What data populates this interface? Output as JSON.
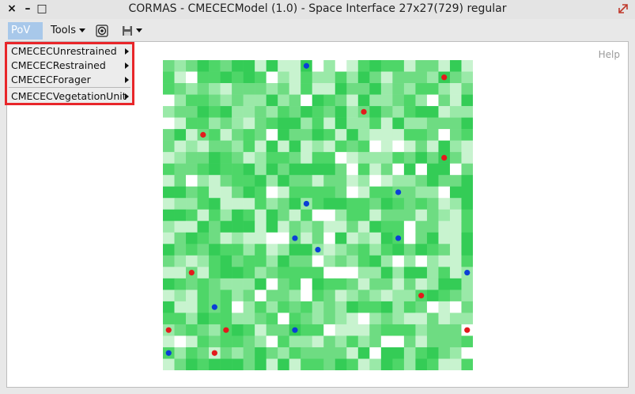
{
  "window": {
    "title": "CORMAS - CMECECModel (1.0) - Space Interface  27x27(729) regular",
    "close_glyph": "×",
    "minimize_glyph": "–",
    "maximize_glyph": "□"
  },
  "toolbar": {
    "pov_label": "PoV",
    "tools_label": "Tools"
  },
  "help_label": "Help",
  "menu": {
    "items": [
      {
        "label": "CMECECUnrestrained"
      },
      {
        "label": "CMECECRestrained"
      },
      {
        "label": "CMECECForager"
      },
      {
        "label": "CMECECVegetationUnit"
      }
    ]
  },
  "colors": {
    "highlight": "#e8262a",
    "active_button": "#a8c8ea",
    "agent_red": "#e31a1c",
    "agent_blue": "#0b3fd6",
    "vegetation_palette": [
      "#ffffff",
      "#c9f4cf",
      "#9aec a6",
      "#6de07f",
      "#4dd865",
      "#33cc55"
    ]
  },
  "grid": {
    "size": 27,
    "agents": [
      {
        "col": 12,
        "row": 0,
        "color": "blue"
      },
      {
        "col": 24,
        "row": 1,
        "color": "red"
      },
      {
        "col": 17,
        "row": 4,
        "color": "red"
      },
      {
        "col": 3,
        "row": 6,
        "color": "red"
      },
      {
        "col": 24,
        "row": 8,
        "color": "red"
      },
      {
        "col": 20,
        "row": 11,
        "color": "blue"
      },
      {
        "col": 12,
        "row": 12,
        "color": "blue"
      },
      {
        "col": 11,
        "row": 15,
        "color": "blue"
      },
      {
        "col": 20,
        "row": 15,
        "color": "blue"
      },
      {
        "col": 13,
        "row": 16,
        "color": "blue"
      },
      {
        "col": 2,
        "row": 18,
        "color": "red"
      },
      {
        "col": 26,
        "row": 18,
        "color": "blue"
      },
      {
        "col": 22,
        "row": 20,
        "color": "red"
      },
      {
        "col": 4,
        "row": 21,
        "color": "blue"
      },
      {
        "col": 0,
        "row": 23,
        "color": "red"
      },
      {
        "col": 5,
        "row": 23,
        "color": "red"
      },
      {
        "col": 11,
        "row": 23,
        "color": "blue"
      },
      {
        "col": 26,
        "row": 23,
        "color": "red"
      },
      {
        "col": 0,
        "row": 25,
        "color": "blue"
      },
      {
        "col": 4,
        "row": 25,
        "color": "red"
      }
    ]
  }
}
